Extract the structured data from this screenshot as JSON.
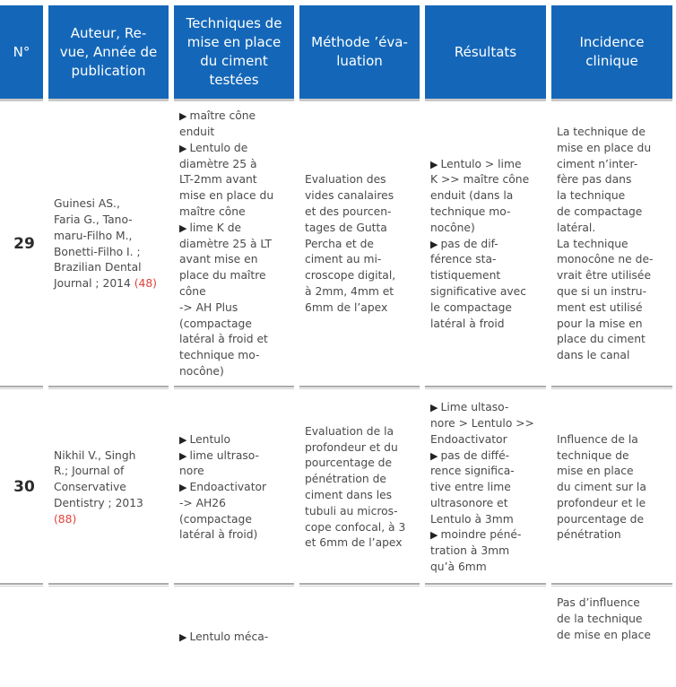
{
  "header": {
    "col0": "N°",
    "col1": "Auteur, Re-\nvue, Année de\npublication",
    "col2": "Techniques de\nmise en place\ndu ciment\ntestées",
    "col3": "Méthode ’éva-\nluation",
    "col4": "Résultats",
    "col5": "Incidence\nclinique"
  },
  "colors": {
    "header_bg": "#1467b8",
    "reference": "#e0413a"
  },
  "rows": [
    {
      "num": "29",
      "author": "Guinesi AS.,\nFaria G., Tano-\nmaru-Filho M.,\nBonetti-Filho I. ;\nBrazilian Dental\nJournal ; 2014 ",
      "ref": "(48)",
      "techniques": [
        "maître cône\nenduit",
        "Lentulo de\ndiamètre 25 à\nLT-2mm avant\nmise en place du\nmaître cône",
        "lime K de\ndiamètre 25 à LT\navant mise en\nplace du maître\ncône"
      ],
      "techniques_tail": "-> AH Plus\n(compactage\nlatéral à froid et\ntechnique mo-\nnocône)",
      "method": "Evaluation des\nvides canalaires\net des pourcen-\ntages de Gutta\nPercha et de\nciment au mi-\ncroscope digital,\nà 2mm, 4mm et\n6mm de l’apex",
      "results": [
        "Lentulo > lime\nK >> maître cône\nenduit (dans la\ntechnique mo-\nnocône)",
        "pas de dif-\nférence sta-\ntistiquement\nsignificative avec\nle compactage\nlatéral à froid"
      ],
      "clinical": "La technique de\nmise en place du\nciment n’inter-\nfère pas dans\nla technique\nde compactage\nlatéral.\nLa technique\nmonocône ne de-\nvrait être utilisée\nque si un instru-\nment est utilisé\npour la mise en\nplace du ciment\ndans le canal"
    },
    {
      "num": "30",
      "author": "Nikhil V., Singh\nR.;  Journal of\nConservative\nDentistry ; 2013\n",
      "ref": "(88)",
      "techniques": [
        "Lentulo",
        "lime ultraso-\nnore",
        "Endoactivator"
      ],
      "techniques_tail": "-> AH26\n(compactage\nlatéral à froid)",
      "method": "Evaluation de la\nprofondeur et du\npourcentage de\npénétration de\nciment dans les\ntubuli au micros-\ncope confocal, à 3\net 6mm de l’apex",
      "results": [
        "Lime ultaso-\nnore > Lentulo >>\nEndoactivator",
        "pas de diffé-\nrence significa-\ntive entre lime\nultrasonore et\nLentulo à 3mm",
        "moindre péné-\ntration à 3mm\nqu’à 6mm"
      ],
      "clinical": "Influence de la\ntechnique de\nmise en place\ndu ciment sur la\nprofondeur et le\npourcentage de\npénétration"
    },
    {
      "techniques": [
        "Lentulo méca-"
      ],
      "clinical": "Pas d’influence\nde la technique\nde mise en place"
    }
  ]
}
